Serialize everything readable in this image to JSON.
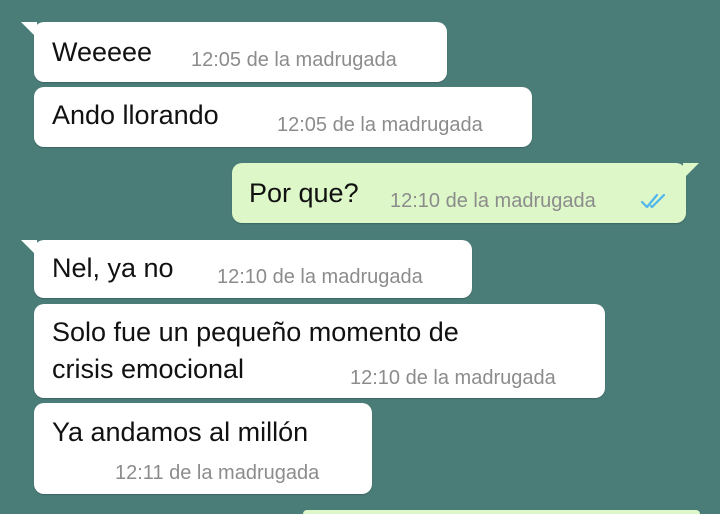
{
  "messages": [
    {
      "direction": "incoming",
      "text": "Weeeee",
      "time": "12:05 de la madrugada"
    },
    {
      "direction": "incoming",
      "text": "Ando llorando",
      "time": "12:05 de la madrugada"
    },
    {
      "direction": "outgoing",
      "text": "Por que?",
      "time": "12:10 de la madrugada",
      "status": "read",
      "status_icon": "double-check-icon",
      "status_color": "#4fb6ec"
    },
    {
      "direction": "incoming",
      "text": "Nel, ya no",
      "time": "12:10 de la madrugada"
    },
    {
      "direction": "incoming",
      "text": "Solo fue un pequeño momento de",
      "text_line2": "crisis emocional",
      "time": "12:10 de la madrugada"
    },
    {
      "direction": "incoming",
      "text": "Ya andamos al millón",
      "time": "12:11 de la madrugada"
    }
  ],
  "colors": {
    "background": "#4a7c78",
    "incoming_bubble": "#ffffff",
    "outgoing_bubble": "#ddf7c8",
    "timestamp": "#8c8c8c"
  }
}
